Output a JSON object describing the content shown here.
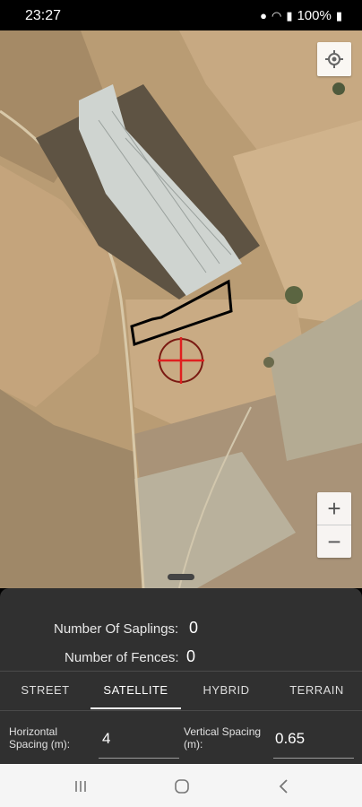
{
  "status_bar": {
    "time": "23:27",
    "battery": "100%",
    "icons": [
      "location-icon",
      "wifi-icon",
      "signal-icon",
      "battery-icon"
    ]
  },
  "map": {
    "type": "satellite",
    "controls": [
      "my-location-icon",
      "zoom-in-icon",
      "zoom-out-icon"
    ],
    "zoom_in": "+",
    "zoom_out": "−"
  },
  "stats": {
    "saplings_label": "Number Of Saplings:",
    "saplings_value": "0",
    "fences_label": "Number of Fences:",
    "fences_value": "0"
  },
  "tabs": [
    {
      "label": "STREET",
      "active": false
    },
    {
      "label": "SATELLITE",
      "active": true
    },
    {
      "label": "HYBRID",
      "active": false
    },
    {
      "label": "TERRAIN",
      "active": false
    }
  ],
  "spacing": {
    "horizontal_label_1": "Horizontal",
    "horizontal_label_2": "Spacing (m):",
    "horizontal_value": "4",
    "vertical_label_1": "Vertical Spacing",
    "vertical_label_2": "(m):",
    "vertical_value": "0.65"
  },
  "nav": {
    "icons": [
      "recent-apps-icon",
      "home-icon",
      "back-icon"
    ]
  },
  "colors": {
    "panel": "#303030",
    "crosshair": "#e02020",
    "polygon": "#000000"
  }
}
